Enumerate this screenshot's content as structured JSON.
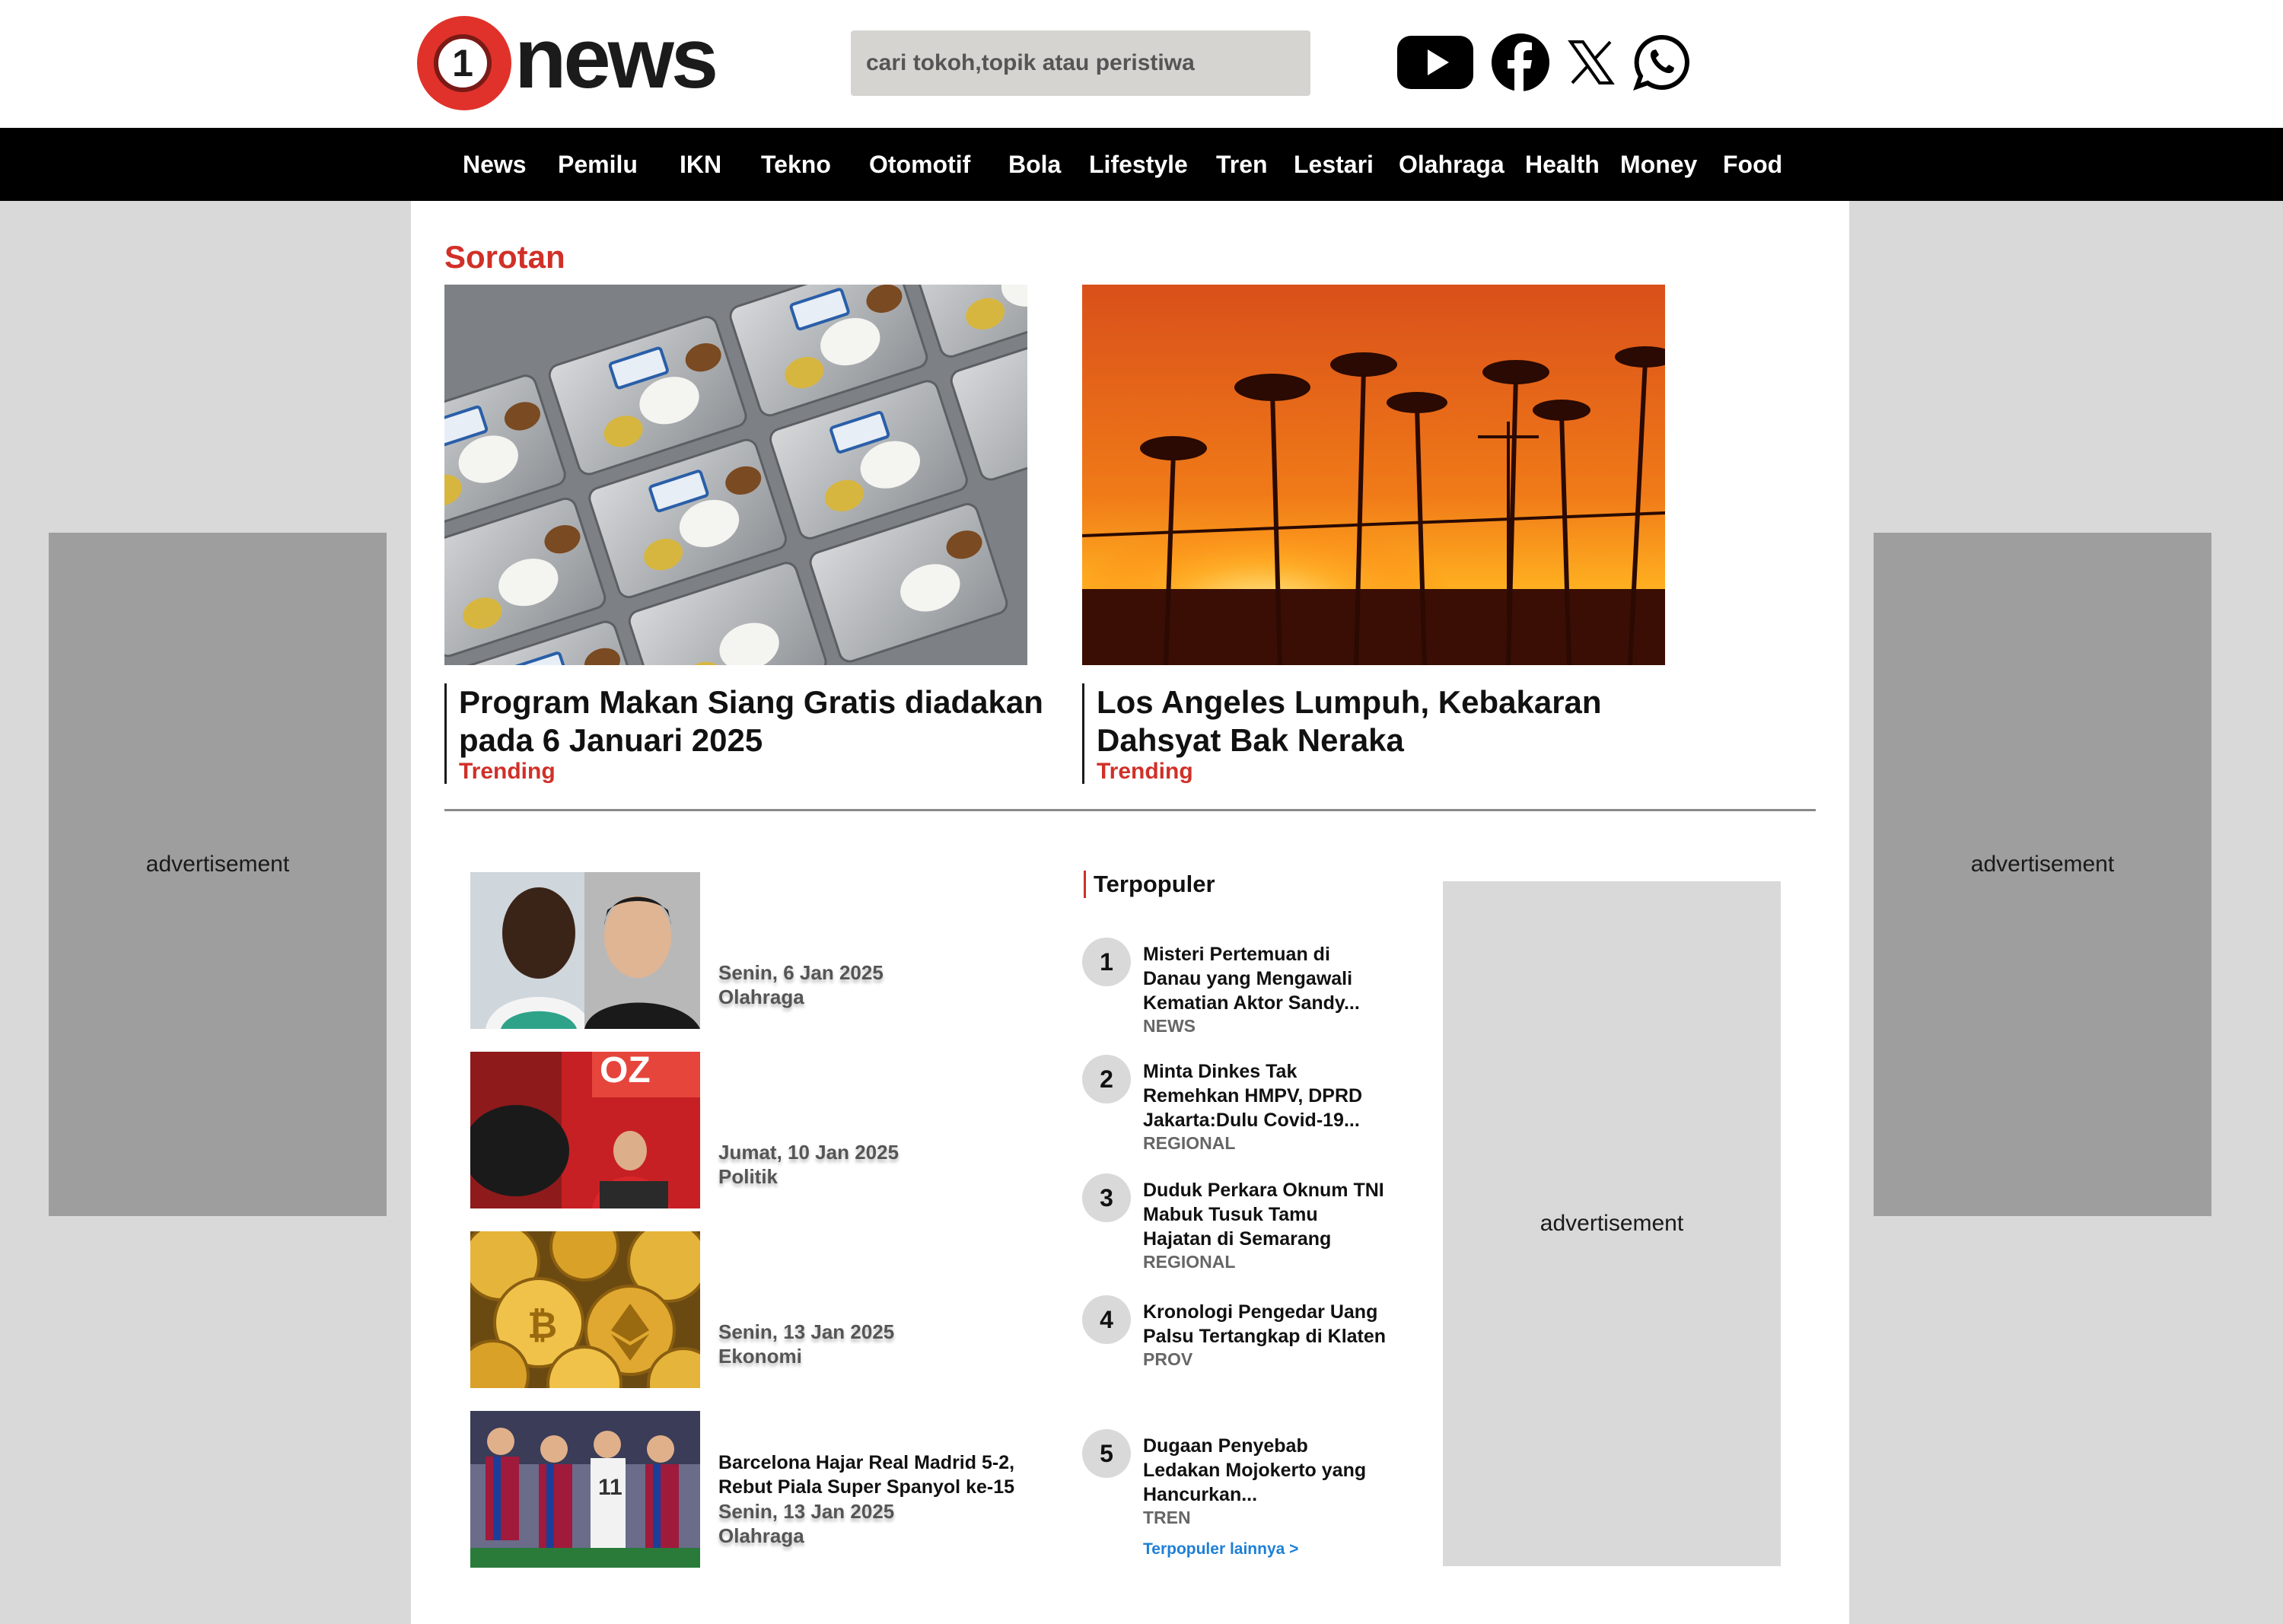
{
  "header": {
    "logo_text": "news",
    "logo_mark": "1",
    "search_placeholder": "cari tokoh,topik atau peristiwa",
    "social_icons": [
      "youtube-icon",
      "facebook-icon",
      "x-icon",
      "whatsapp-icon"
    ]
  },
  "nav": {
    "items": [
      "News",
      "Pemilu",
      "IKN",
      "Tekno",
      "Otomotif",
      "Bola",
      "Lifestyle",
      "Tren",
      "Lestari",
      "Olahraga",
      "Health",
      "Money",
      "Food"
    ]
  },
  "ads": {
    "left": "advertisement",
    "right": "advertisement",
    "sidebar": "advertisement"
  },
  "sorotan": {
    "heading": "Sorotan",
    "features": [
      {
        "title": "Program Makan Siang Gratis diadakan pada 6 Januari 2025",
        "tag": "Trending",
        "image": "school-lunch-trays-photo"
      },
      {
        "title": "Los Angeles Lumpuh, Kebakaran Dahsyat Bak Neraka",
        "tag": "Trending",
        "image": "wildfire-palm-trees-photo"
      }
    ]
  },
  "latest": [
    {
      "title": "",
      "date": "Senin, 6 Jan 2025",
      "category": "Olahraga",
      "image": "football-coaches-photo"
    },
    {
      "title": "",
      "date": "Jumat, 10 Jan 2025",
      "category": "Politik",
      "image": "politician-speech-photo"
    },
    {
      "title": "",
      "date": "Senin, 13 Jan 2025",
      "category": "Ekonomi",
      "image": "crypto-coins-photo"
    },
    {
      "title": "Barcelona Hajar Real Madrid 5-2, Rebut Piala Super Spanyol ke-15",
      "date": "Senin, 13 Jan 2025",
      "category": "Olahraga",
      "image": "barcelona-players-photo"
    }
  ],
  "terpopuler": {
    "heading": "Terpopuler",
    "items": [
      {
        "rank": "1",
        "title": "Misteri Pertemuan di Danau yang Mengawali Kematian Aktor Sandy...",
        "category": "NEWS"
      },
      {
        "rank": "2",
        "title": "Minta Dinkes Tak Remehkan HMPV, DPRD Jakarta:Dulu Covid-19...",
        "category": "REGIONAL"
      },
      {
        "rank": "3",
        "title": "Duduk Perkara Oknum TNI Mabuk Tusuk Tamu Hajatan di Semarang",
        "category": "REGIONAL"
      },
      {
        "rank": "4",
        "title": "Kronologi Pengedar Uang Palsu Tertangkap di Klaten",
        "category": "PROV"
      },
      {
        "rank": "5",
        "title": "Dugaan Penyebab Ledakan Mojokerto yang Hancurkan...",
        "category": "TREN"
      }
    ],
    "more_link": "Terpopuler lainnya >"
  },
  "colors": {
    "accent_red": "#d03028",
    "nav_bg": "#000000",
    "link_blue": "#1e7fd6",
    "ad_gray": "#9e9e9e"
  }
}
